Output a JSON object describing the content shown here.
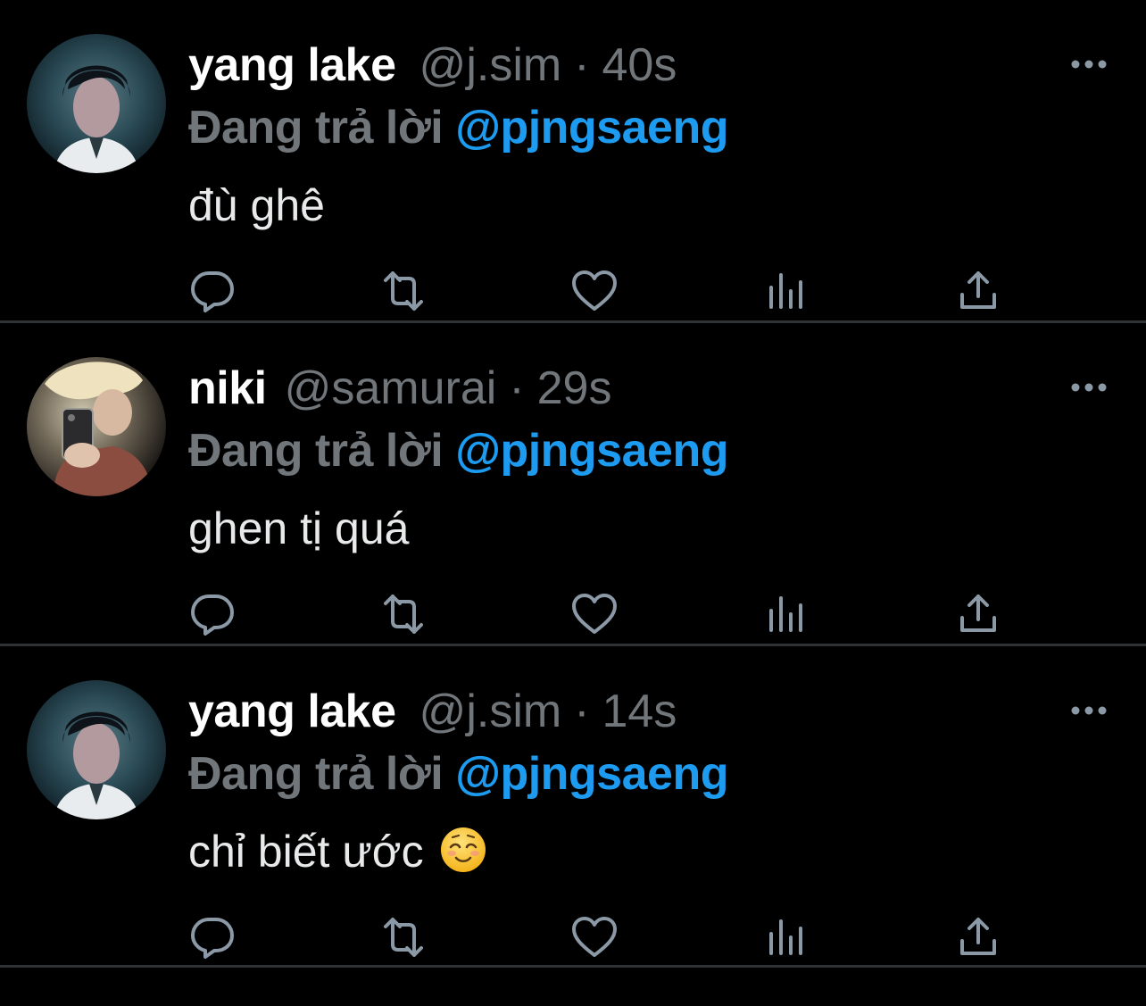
{
  "colors": {
    "background": "#000000",
    "secondary_text": "#71767b",
    "mention": "#1d9bf0",
    "divider": "#2f3336",
    "icon": "#8b98a5"
  },
  "tweets": [
    {
      "name": "yang lake",
      "handle": "@j.sim",
      "separator": "·",
      "time": "40s",
      "reply_prefix": "Đang trả lời",
      "reply_to": "@pjngsaeng",
      "text": "đù ghê",
      "emoji": ""
    },
    {
      "name": "niki",
      "handle": "@samurai",
      "separator": "·",
      "time": "29s",
      "reply_prefix": "Đang trả lời",
      "reply_to": "@pjngsaeng",
      "text": "ghen tị quá",
      "emoji": ""
    },
    {
      "name": "yang lake",
      "handle": "@j.sim",
      "separator": "·",
      "time": "14s",
      "reply_prefix": "Đang trả lời",
      "reply_to": "@pjngsaeng",
      "text": "chỉ biết ước",
      "emoji": "smiling-face-emoji"
    }
  ],
  "icons": {
    "more": "more-horizontal-icon",
    "reply": "reply-bubble-icon",
    "retweet": "retweet-icon",
    "like": "heart-icon",
    "views": "analytics-bars-icon",
    "share": "share-upload-icon"
  }
}
